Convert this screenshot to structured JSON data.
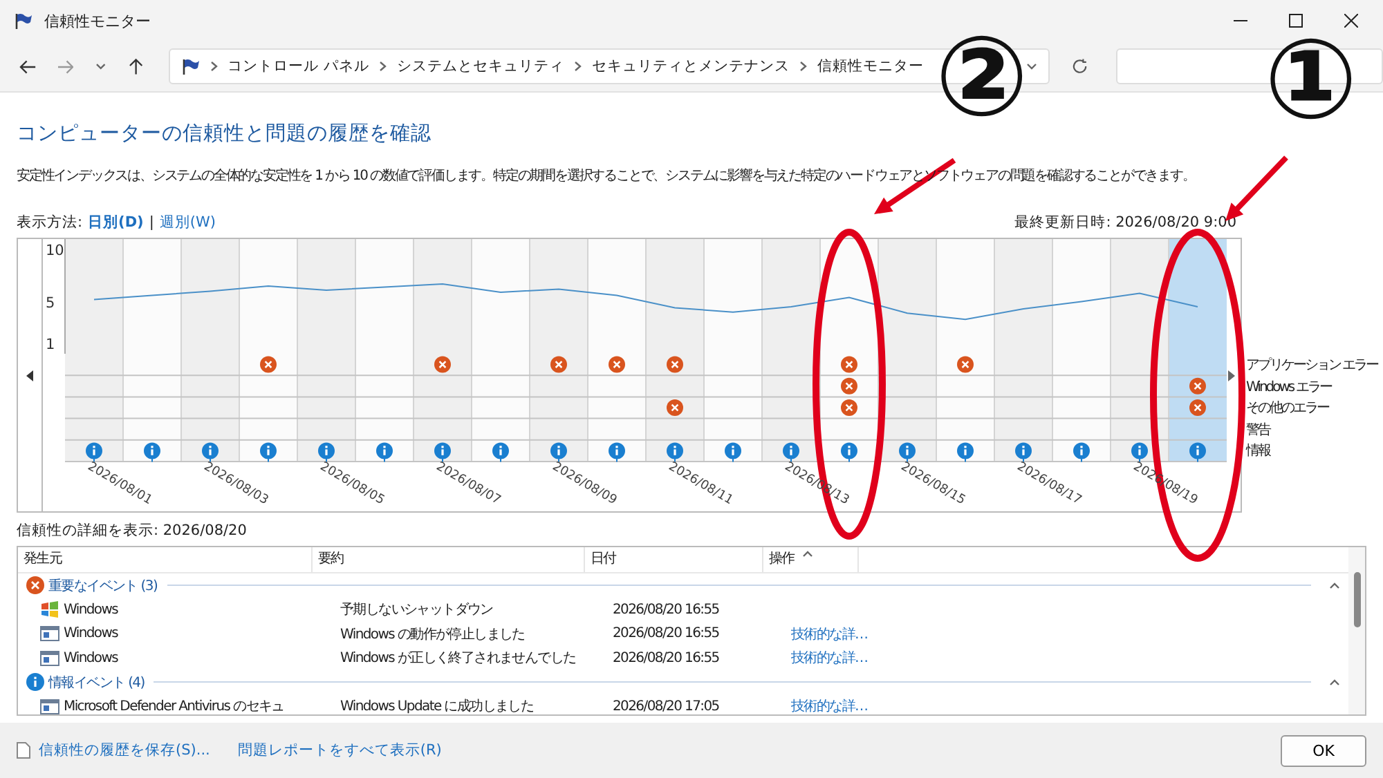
{
  "window": {
    "title": "信頼性モニター"
  },
  "address": {
    "breadcrumb": [
      "コントロール パネル",
      "システムとセキュリティ",
      "セキュリティとメンテナンス",
      "信頼性モニター"
    ]
  },
  "heading": "コンピューターの信頼性と問題の履歴を確認",
  "description": "安定性インデックスは、システムの全体的な安定性を 1 から 10 の数値で評価します。特定の期間を選択することで、システムに影響を与えた特定のハードウェアとソフトウェアの問題を確認することができます。",
  "view": {
    "label": "表示方法:",
    "separator": "|",
    "options": [
      {
        "label": "日別(D)",
        "selected": true
      },
      {
        "label": "週別(W)",
        "selected": false
      }
    ]
  },
  "last_updated": "最終更新日時: 2026/08/20 9:00",
  "chart": {
    "chart_data": {
      "type": "line",
      "ylim": [
        0,
        11
      ],
      "yticks": [
        1,
        5,
        10
      ],
      "grid": true,
      "series": [
        {
          "color": "#4a90c8",
          "values": [
            5.2,
            5.6,
            6.0,
            6.5,
            6.1,
            6.4,
            6.7,
            5.9,
            6.2,
            5.6,
            4.4,
            4.0,
            4.5,
            5.4,
            3.9,
            3.3,
            4.3,
            5.0,
            5.8,
            4.5
          ]
        }
      ]
    },
    "event_rows": [
      "アプリケーション エラー",
      "Windows エラー",
      "その他のエラー",
      "警告",
      "情報"
    ],
    "days": [
      {
        "date_label": "2026/08/01",
        "selected": false,
        "app_error": false,
        "windows_error": false,
        "other_error": false,
        "warning": false,
        "info": true
      },
      {
        "selected": false,
        "app_error": false,
        "windows_error": false,
        "other_error": false,
        "warning": false,
        "info": true
      },
      {
        "date_label": "2026/08/03",
        "selected": false,
        "app_error": false,
        "windows_error": false,
        "other_error": false,
        "warning": false,
        "info": true
      },
      {
        "selected": false,
        "app_error": true,
        "windows_error": false,
        "other_error": false,
        "warning": false,
        "info": true
      },
      {
        "date_label": "2026/08/05",
        "selected": false,
        "app_error": false,
        "windows_error": false,
        "other_error": false,
        "warning": false,
        "info": true
      },
      {
        "selected": false,
        "app_error": false,
        "windows_error": false,
        "other_error": false,
        "warning": false,
        "info": true
      },
      {
        "date_label": "2026/08/07",
        "selected": false,
        "app_error": true,
        "windows_error": false,
        "other_error": false,
        "warning": false,
        "info": true
      },
      {
        "selected": false,
        "app_error": false,
        "windows_error": false,
        "other_error": false,
        "warning": false,
        "info": true
      },
      {
        "date_label": "2026/08/09",
        "selected": false,
        "app_error": true,
        "windows_error": false,
        "other_error": false,
        "warning": false,
        "info": true
      },
      {
        "selected": false,
        "app_error": true,
        "windows_error": false,
        "other_error": false,
        "warning": false,
        "info": true
      },
      {
        "date_label": "2026/08/11",
        "selected": false,
        "app_error": true,
        "windows_error": false,
        "other_error": true,
        "warning": false,
        "info": true
      },
      {
        "selected": false,
        "app_error": false,
        "windows_error": false,
        "other_error": false,
        "warning": false,
        "info": true
      },
      {
        "date_label": "2026/08/13",
        "selected": false,
        "app_error": false,
        "windows_error": false,
        "other_error": false,
        "warning": false,
        "info": true
      },
      {
        "selected": false,
        "app_error": true,
        "windows_error": true,
        "other_error": true,
        "warning": false,
        "info": true
      },
      {
        "date_label": "2026/08/15",
        "selected": false,
        "app_error": false,
        "windows_error": false,
        "other_error": false,
        "warning": false,
        "info": true
      },
      {
        "selected": false,
        "app_error": true,
        "windows_error": false,
        "other_error": false,
        "warning": false,
        "info": true
      },
      {
        "date_label": "2026/08/17",
        "selected": false,
        "app_error": false,
        "windows_error": false,
        "other_error": false,
        "warning": false,
        "info": true
      },
      {
        "selected": false,
        "app_error": false,
        "windows_error": false,
        "other_error": false,
        "warning": false,
        "info": true
      },
      {
        "date_label": "2026/08/19",
        "selected": false,
        "app_error": false,
        "windows_error": false,
        "other_error": false,
        "warning": false,
        "info": true
      },
      {
        "selected": true,
        "app_error": false,
        "windows_error": true,
        "other_error": true,
        "warning": false,
        "info": true
      }
    ]
  },
  "details_label": "信頼性の詳細を表示: 2026/08/20",
  "table": {
    "columns": [
      "発生元",
      "要約",
      "日付",
      "操作"
    ],
    "groups": [
      {
        "kind": "error",
        "label": "重要なイベント (3)",
        "expanded": true,
        "rows": [
          {
            "kind": "shutdown",
            "source": "Windows",
            "summary": "予期しないシャットダウン",
            "date": "2026/08/20 16:55"
          },
          {
            "kind": "app",
            "source": "Windows",
            "summary": "Windows の動作が停止しました",
            "date": "2026/08/20 16:55",
            "action": "技術的な詳…"
          },
          {
            "kind": "app",
            "source": "Windows",
            "summary": "Windows が正しく終了されませんでした",
            "date": "2026/08/20 16:55",
            "action": "技術的な詳…"
          }
        ]
      },
      {
        "kind": "info",
        "label": "情報イベント (4)",
        "expanded": true,
        "rows": [
          {
            "kind": "app",
            "source": "Microsoft Defender Antivirus のセキュ",
            "summary": "Windows Update に成功しました",
            "date": "2026/08/20 17:05",
            "action": "技術的な詳…"
          }
        ]
      }
    ]
  },
  "footer": {
    "links": [
      "信頼性の履歴を保存(S)...",
      "問題レポートをすべて表示(R)"
    ],
    "button": "OK"
  },
  "annotations": [
    {
      "label": "②"
    },
    {
      "label": "①"
    }
  ]
}
